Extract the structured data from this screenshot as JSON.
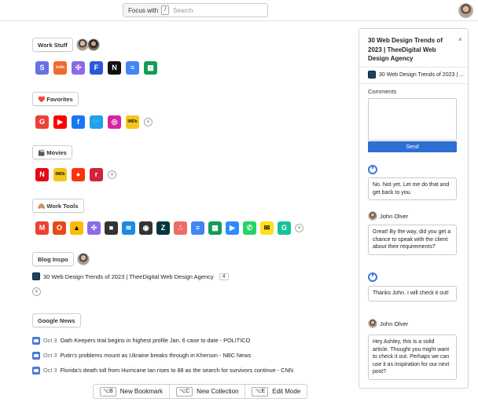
{
  "header": {
    "focus_label": "Focus with",
    "focus_key": "/",
    "search_placeholder": "Search"
  },
  "sections": {
    "work_stuff": {
      "title": "Work Stuff",
      "icons": [
        {
          "name": "stripe-icon",
          "glyph": "S",
          "color": "#6772e5"
        },
        {
          "name": "todoist-icon",
          "glyph": "todo",
          "color": "#ee6a2c"
        },
        {
          "name": "clickup-icon",
          "glyph": "✣",
          "color": "#8c6be8"
        },
        {
          "name": "fabric-icon",
          "glyph": "F",
          "color": "#2a5bd7"
        },
        {
          "name": "notion-icon",
          "glyph": "N",
          "color": "#111111"
        },
        {
          "name": "google-docs-icon",
          "glyph": "≡",
          "color": "#4285f4"
        },
        {
          "name": "google-sheets-icon",
          "glyph": "▦",
          "color": "#0f9d58"
        }
      ]
    },
    "favorites": {
      "title": "❤️ Favorites",
      "icons": [
        {
          "name": "google-icon",
          "glyph": "G",
          "color": "#ea4335"
        },
        {
          "name": "youtube-icon",
          "glyph": "▶",
          "color": "#ff0000"
        },
        {
          "name": "facebook-icon",
          "glyph": "f",
          "color": "#1877f2"
        },
        {
          "name": "twitter-icon",
          "glyph": "🐦",
          "color": "#1da1f2"
        },
        {
          "name": "instagram-icon",
          "glyph": "◎",
          "color": "#d6249f"
        },
        {
          "name": "imdb-icon",
          "glyph": "IMDb",
          "color": "#f5c518"
        }
      ]
    },
    "movies": {
      "title": "🎬 Movies",
      "icons": [
        {
          "name": "netflix-icon",
          "glyph": "N",
          "color": "#e50914"
        },
        {
          "name": "imdb-icon",
          "glyph": "IMDb",
          "color": "#f5c518"
        },
        {
          "name": "rotten-tomatoes-icon",
          "glyph": "●",
          "color": "#fa320a"
        },
        {
          "name": "letterboxd-icon",
          "glyph": "r",
          "color": "#d0243b"
        }
      ]
    },
    "work_tools": {
      "title": "🙈 Work Tools",
      "icons": [
        {
          "name": "gmail-icon",
          "glyph": "M",
          "color": "#ea4335"
        },
        {
          "name": "office-icon",
          "glyph": "O",
          "color": "#e64a19"
        },
        {
          "name": "google-ads-icon",
          "glyph": "▲",
          "color": "#fbbc04"
        },
        {
          "name": "clickup-icon",
          "glyph": "✣",
          "color": "#8c6be8"
        },
        {
          "name": "book-icon",
          "glyph": "■",
          "color": "#333333"
        },
        {
          "name": "stack-icon",
          "glyph": "≋",
          "color": "#1e88e5"
        },
        {
          "name": "camera-icon",
          "glyph": "◉",
          "color": "#333333"
        },
        {
          "name": "zendesk-icon",
          "glyph": "Z",
          "color": "#03363d"
        },
        {
          "name": "asana-icon",
          "glyph": "∴",
          "color": "#f06a6a"
        },
        {
          "name": "google-docs-icon",
          "glyph": "≡",
          "color": "#4285f4"
        },
        {
          "name": "google-sheets-icon",
          "glyph": "▦",
          "color": "#0f9d58"
        },
        {
          "name": "zoom-icon",
          "glyph": "▶",
          "color": "#2d8cff"
        },
        {
          "name": "whatsapp-icon",
          "glyph": "✆",
          "color": "#25d366"
        },
        {
          "name": "mailchimp-icon",
          "glyph": "✉",
          "color": "#ffe01b"
        },
        {
          "name": "grammarly-icon",
          "glyph": "G",
          "color": "#15c39a"
        }
      ]
    },
    "blog_inspo": {
      "title": "Blog Inspo",
      "item_title": "30 Web Design Trends of 2023 | TheeDigital Web Design Agency",
      "item_count": "4"
    },
    "google_news": {
      "title": "Google News",
      "items": [
        {
          "date": "Oct 3",
          "title": "Oath Keepers trial begins in highest profile Jan. 6 case to date - POLITICO"
        },
        {
          "date": "Oct 3",
          "title": "Putin's problems mount as Ukraine breaks through in Kherson - NBC News"
        },
        {
          "date": "Oct 3",
          "title": "Florida's death toll from Hurricane Ian rises to 88 as the search for survivors continue - CNN"
        }
      ]
    }
  },
  "bottombar": {
    "new_bookmark_key": "⌥B",
    "new_bookmark_label": "New Bookmark",
    "new_collection_key": "⌥C",
    "new_collection_label": "New Collection",
    "edit_mode_key": "⌥E",
    "edit_mode_label": "Edit Mode"
  },
  "panel": {
    "title": "30 Web Design Trends of 2023 | TheeDigital Web Design Agency",
    "close": "×",
    "link_title": "30 Web Design Trends of 2023 | ...",
    "comments_label": "Comments",
    "send_label": "Send",
    "comments": [
      {
        "author": "",
        "text": "No. Not yet. Let me do that and get back to you."
      },
      {
        "author": "John Olver",
        "text": "Great! By the way, did you get a chance to speak with the client about their requirements?"
      },
      {
        "author": "",
        "text": "Thanks John. I will check it out!"
      },
      {
        "author": "John Olver",
        "text": "Hey Ashley, this is a solid article. Thought you might want to check it out. Perhaps we can use it as inspiration for our next post?"
      }
    ]
  }
}
